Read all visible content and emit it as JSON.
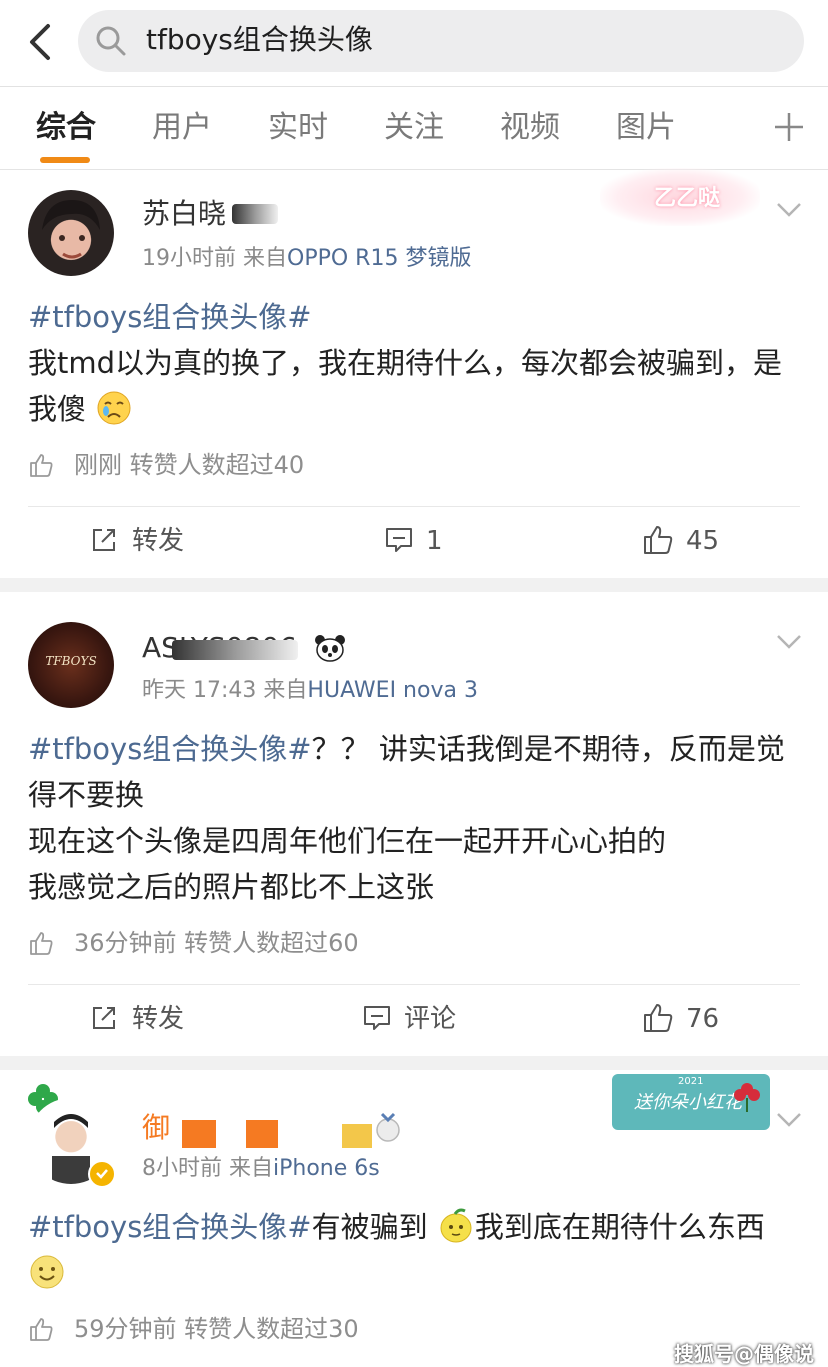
{
  "search": {
    "query": "tfboys组合换头像"
  },
  "tabs": [
    "综合",
    "用户",
    "实时",
    "关注",
    "视频",
    "图片"
  ],
  "posts": [
    {
      "name": "苏白晓",
      "time": "19小时前",
      "from": "来自",
      "source": "OPPO R15 梦镜版",
      "hashtag": "#tfboys组合换头像#",
      "text": "我tmd以为真的换了，我在期待什么，每次都会被骗到，是我傻",
      "like_note": "刚刚 转赞人数超过40",
      "repost": "转发",
      "comment": "1",
      "likes": "45",
      "decoration": "乙乙哒"
    },
    {
      "name": "ASLYS0806",
      "time": "昨天 17:43",
      "from": "来自",
      "source": "HUAWEI nova 3",
      "hashtag": "#tfboys组合换头像#",
      "text_line1": "？？ 讲实话我倒是不期待，反而是觉得不要换",
      "text_line2": "现在这个头像是四周年他们仨在一起开开心心拍的",
      "text_line3": "我感觉之后的照片都比不上这张",
      "avatar_label": "TFBOYS",
      "like_note": "36分钟前 转赞人数超过60",
      "repost": "转发",
      "comment": "评论",
      "likes": "76"
    },
    {
      "name": "御",
      "time": "8小时前",
      "from": "来自",
      "source": "iPhone 6s",
      "hashtag": "#tfboys组合换头像#",
      "text_a": "有被骗到",
      "text_b": "我到底在期待什么东西",
      "like_note": "59分钟前 转赞人数超过30",
      "card": "送你朵小红花",
      "card_year": "2021"
    }
  ],
  "watermark": "搜狐号@偶像说",
  "colors": {
    "accent": "#f08a16",
    "link": "#4d6a91",
    "badge": "#f5b400"
  }
}
